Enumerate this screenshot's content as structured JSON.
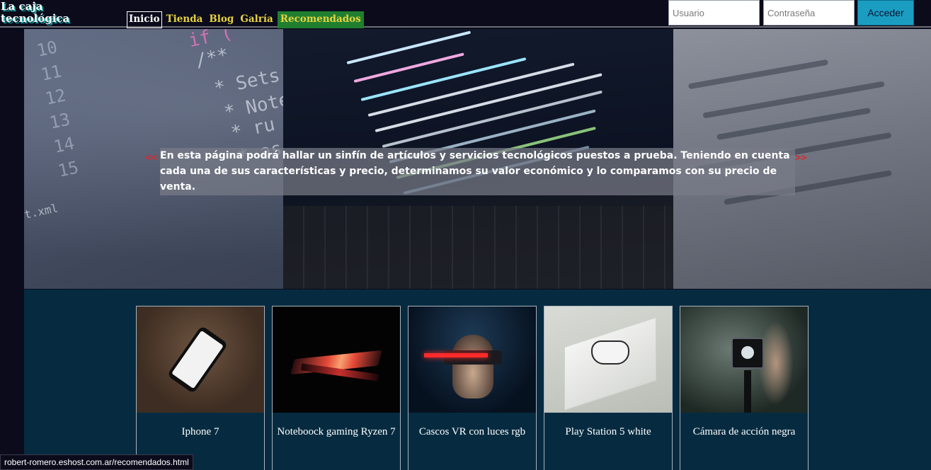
{
  "header": {
    "logo_line1": "La caja",
    "logo_line2": "tecnológica",
    "nav": [
      {
        "label": "Inicio",
        "state": "active"
      },
      {
        "label": "Tienda"
      },
      {
        "label": "Blog"
      },
      {
        "label": "Galría"
      },
      {
        "label": "Recomendados",
        "state": "highlight"
      }
    ],
    "login": {
      "user_placeholder": "Usuario",
      "pass_placeholder": "Contraseña",
      "submit_label": "Acceder"
    }
  },
  "hero": {
    "arrow_left": "<<",
    "arrow_right": ">>",
    "text": "En esta página podrá hallar un sinfín de artículos y servicios tecnológicos puestos a prueba. Teniendo en cuenta cada una de sus características y precio, determinamos su valor económico y lo comparamos con su precio de venta.",
    "code_text": [
      "if (",
      "/**",
      "* Sets",
      "* Note",
      "* ru",
      "* as",
      "t.xml"
    ],
    "line_numbers": [
      "10",
      "11",
      "12",
      "13",
      "14",
      "15"
    ]
  },
  "products": [
    {
      "title": "Iphone 7",
      "image": "iphone-photo"
    },
    {
      "title": "Noteboock gaming Ryzen 7",
      "image": "laptop-photo"
    },
    {
      "title": "Cascos VR con luces rgb",
      "image": "vr-headset-photo"
    },
    {
      "title": "Play Station 5 white",
      "image": "ps5-photo"
    },
    {
      "title": "Cámara de acción negra",
      "image": "action-camera-photo"
    }
  ],
  "statusbar": {
    "url": "robert-romero.eshost.com.ar/recomendados.html"
  },
  "colors": {
    "header_bg": "#0b0b1c",
    "nav_link": "#e8d240",
    "nav_highlight_bg": "#1f7f2f",
    "button_bg": "#1b9dc2",
    "products_bg": "#062b40",
    "arrow": "#e0262c"
  }
}
